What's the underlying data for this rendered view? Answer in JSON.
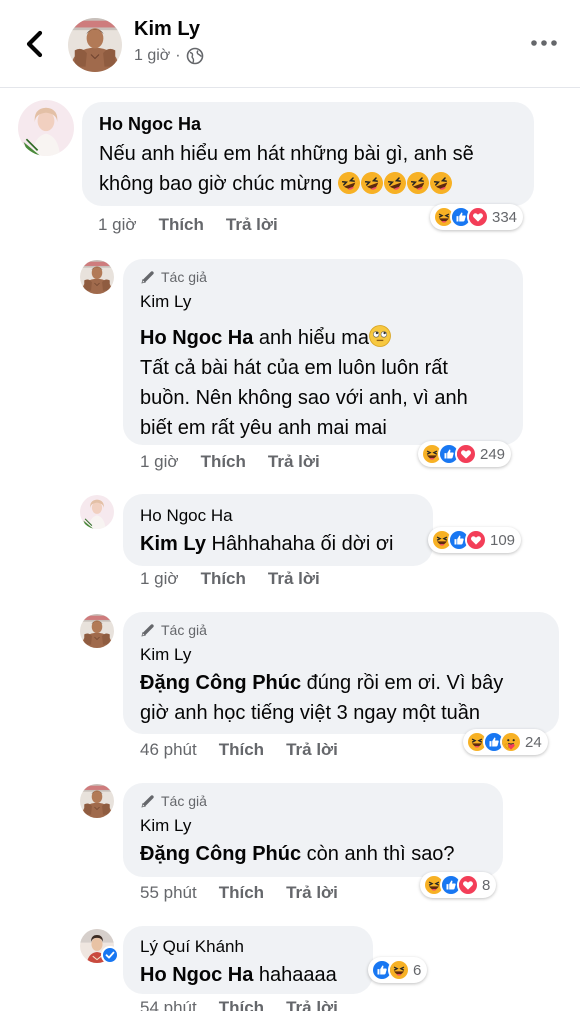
{
  "header": {
    "name": "Kim Ly",
    "time": "1 giờ",
    "separator": "·"
  },
  "comments": [
    {
      "author": "Ho Ngoc Ha",
      "text_line1": "Nếu anh hiểu em hát những bài gì, anh sẽ",
      "text_line2": "không bao giờ chúc mừng",
      "time": "1 giờ",
      "like_label": "Thích",
      "reply_label": "Trả lời",
      "reaction_count": "334"
    },
    {
      "author_badge": "Tác giả",
      "author": "Kim Ly",
      "mention": "Ho Ngoc Ha",
      "text_line1": " anh hiểu ma",
      "text_line2": "Tất cả bài hát của em luôn luôn rất",
      "text_line3": "buồn. Nên không sao với anh, vì anh",
      "text_line4": "biết em rất yêu anh mai mai",
      "time": "1 giờ",
      "like_label": "Thích",
      "reply_label": "Trả lời",
      "reaction_count": "249"
    },
    {
      "author": "Ho Ngoc Ha",
      "mention": "Kim Ly",
      "text": " Hâhhahaha ối dời ơi",
      "time": "1 giờ",
      "like_label": "Thích",
      "reply_label": "Trả lời",
      "reaction_count": "109"
    },
    {
      "author_badge": "Tác giả",
      "author": "Kim Ly",
      "mention": "Đặng Công Phúc",
      "text_line1": " đúng rồi em ơi. Vì bây",
      "text_line2": "giờ anh học tiếng việt 3 ngay một tuần",
      "time": "46 phút",
      "like_label": "Thích",
      "reply_label": "Trả lời",
      "reaction_count": "24"
    },
    {
      "author_badge": "Tác giả",
      "author": "Kim Ly",
      "mention": "Đặng Công Phúc",
      "text": " còn anh thì sao?",
      "time": "55 phút",
      "like_label": "Thích",
      "reply_label": "Trả lời",
      "reaction_count": "8"
    },
    {
      "author": "Lý Quí Khánh",
      "mention": "Ho Ngoc Ha",
      "text": " hahaaaa",
      "time": "54 phút",
      "like_label": "Thích",
      "reply_label": "Trả lời",
      "reaction_count": "6"
    }
  ],
  "colors": {
    "bubble": "#f0f2f5",
    "secondary_text": "#65676b",
    "like_blue": "#1877f2",
    "love_red": "#f33e58",
    "haha_yellow": "#f7b125"
  },
  "icons": [
    "back-arrow-icon",
    "globe-icon",
    "more-icon",
    "pencil-icon",
    "verified-icon",
    "haha-icon",
    "like-icon",
    "love-icon",
    "care-icon"
  ]
}
